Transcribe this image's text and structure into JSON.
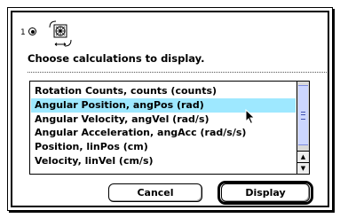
{
  "header": {
    "channel_number": "1",
    "channel_selected": true,
    "sensor_icon": "rotary-motion-sensor-icon"
  },
  "prompt": "Choose calculations to display.",
  "list": {
    "items": [
      "Rotation Counts, counts (counts)",
      "Angular Position, angPos (rad)",
      "Angular Velocity, angVel (rad/s)",
      "Angular Acceleration, angAcc (rad/s/s)",
      "Position, linPos (cm)",
      "Velocity, linVel (cm/s)"
    ],
    "selected_index": 1,
    "selection_color": "#9ee8ff"
  },
  "buttons": {
    "cancel": "Cancel",
    "display": "Display"
  }
}
